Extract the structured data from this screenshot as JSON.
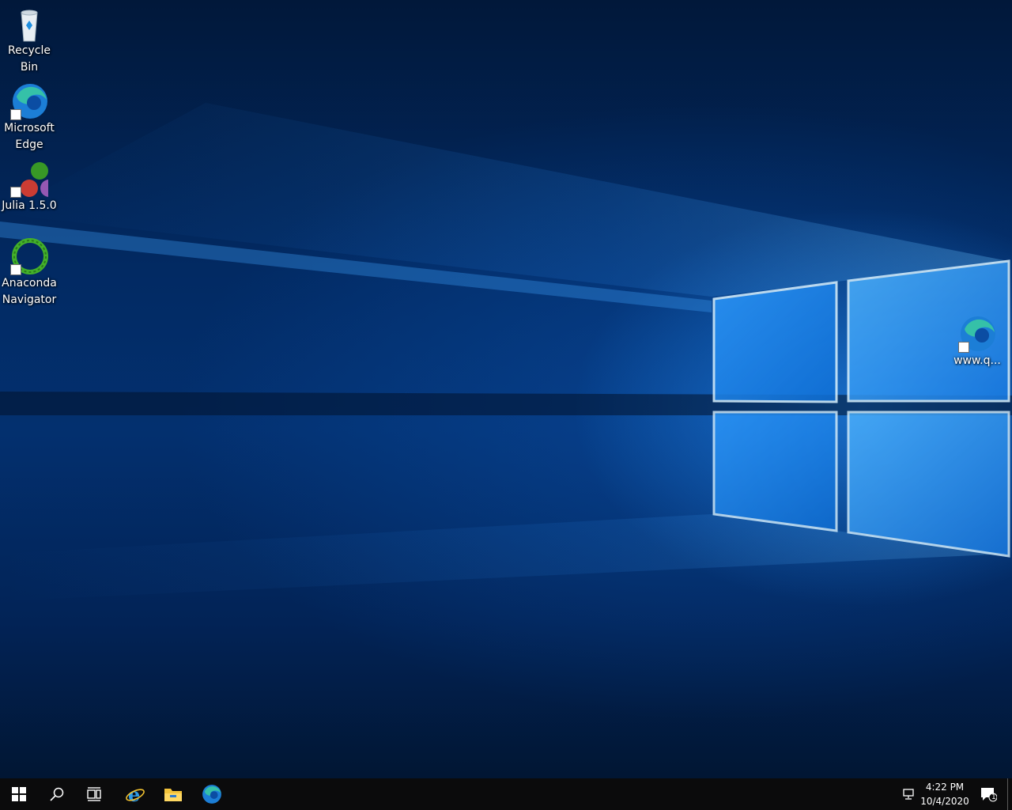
{
  "desktop": {
    "icons": [
      {
        "label": "Recycle Bin",
        "icon": "recycle-bin-icon"
      },
      {
        "label": "Microsoft Edge",
        "icon": "edge-icon"
      },
      {
        "label": "Julia 1.5.0",
        "icon": "julia-icon"
      },
      {
        "label": "Anaconda Navigator",
        "icon": "anaconda-icon"
      },
      {
        "label": "www.q...",
        "icon": "edge-icon"
      }
    ]
  },
  "taskbar": {
    "buttons": [
      {
        "icon": "windows-start-icon"
      },
      {
        "icon": "search-icon"
      },
      {
        "icon": "task-view-icon"
      },
      {
        "icon": "internet-explorer-icon"
      },
      {
        "icon": "file-explorer-icon"
      },
      {
        "icon": "edge-icon"
      }
    ],
    "tray": {
      "network_icon": "network-icon",
      "time": "4:22 PM",
      "date": "10/4/2020",
      "notification_icon": "action-center-icon",
      "notification_count": "1"
    }
  },
  "colors": {
    "taskbar": "#0b0b0c",
    "wallpaper_dark": "#01183a",
    "wallpaper_light": "#2a9bff"
  }
}
